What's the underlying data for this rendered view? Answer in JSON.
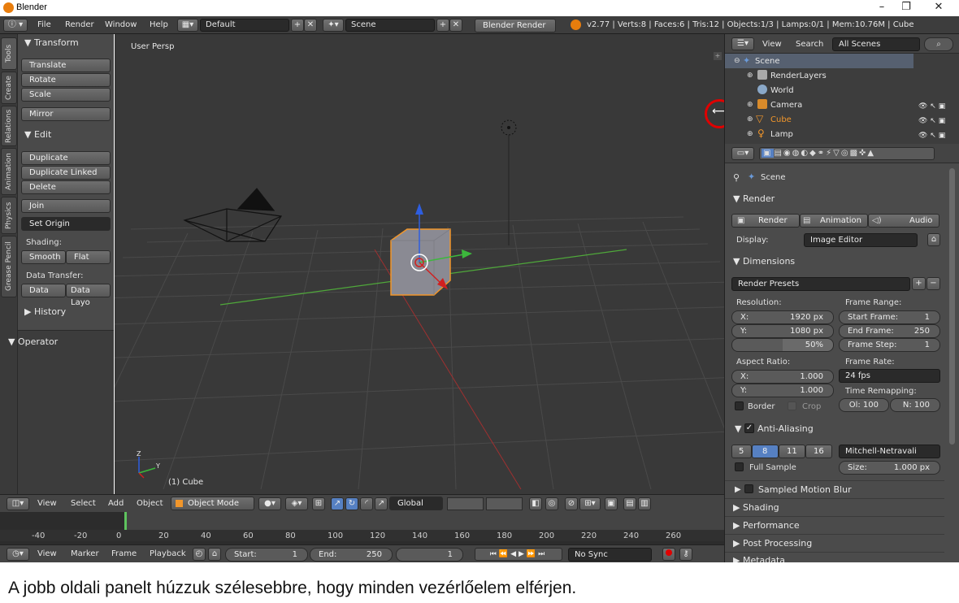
{
  "window": {
    "title": "Blender",
    "minimize": "–",
    "restore": "❐",
    "close": "✕"
  },
  "infobar": {
    "menus": [
      "File",
      "Render",
      "Window",
      "Help"
    ],
    "layout": "Default",
    "scene": "Scene",
    "engine": "Blender Render",
    "stats": "v2.77 | Verts:8 | Faces:6 | Tris:12 | Objects:1/3 | Lamps:0/1 | Mem:10.76M | Cube"
  },
  "tabs": [
    "Tools",
    "Create",
    "Relations",
    "Animation",
    "Physics",
    "Grease Pencil"
  ],
  "toolshelf": {
    "transform": {
      "title": "▼ Transform",
      "buttons": [
        "Translate",
        "Rotate",
        "Scale"
      ],
      "mirror": "Mirror"
    },
    "edit": {
      "title": "▼ Edit",
      "buttons": [
        "Duplicate",
        "Duplicate Linked",
        "Delete"
      ],
      "join": "Join",
      "set_origin": "Set Origin"
    },
    "shading": {
      "label": "Shading:",
      "smooth": "Smooth",
      "flat": "Flat"
    },
    "data_transfer": {
      "label": "Data Transfer:",
      "data": "Data",
      "data_layout": "Data Layo"
    },
    "history": "▶ History",
    "operator": "▼ Operator"
  },
  "viewport": {
    "view_label": "User Persp",
    "object_label": "(1) Cube",
    "axis_x": "Y",
    "axis_z": "Z"
  },
  "viewport_header": {
    "menus": [
      "View",
      "Select",
      "Add",
      "Object"
    ],
    "mode": "Object Mode",
    "orientation": "Global"
  },
  "timeline": {
    "ticks": [
      "-40",
      "-20",
      "0",
      "20",
      "40",
      "60",
      "80",
      "100",
      "120",
      "140",
      "160",
      "180",
      "200",
      "220",
      "240",
      "260"
    ],
    "menus": [
      "View",
      "Marker",
      "Frame",
      "Playback"
    ],
    "start_label": "Start:",
    "start": "1",
    "end_label": "End:",
    "end": "250",
    "current": "1",
    "sync": "No Sync"
  },
  "outliner": {
    "view": "View",
    "search": "Search",
    "filter": "All Scenes",
    "items": [
      {
        "name": "Scene"
      },
      {
        "name": "RenderLayers"
      },
      {
        "name": "World"
      },
      {
        "name": "Camera"
      },
      {
        "name": "Cube"
      },
      {
        "name": "Lamp"
      }
    ]
  },
  "properties": {
    "context": "Scene",
    "render": {
      "title": "▼ Render",
      "render_btn": "Render",
      "animation_btn": "Animation",
      "audio_btn": "Audio",
      "display_label": "Display:",
      "display": "Image Editor"
    },
    "dimensions": {
      "title": "▼ Dimensions",
      "presets": "Render Presets",
      "resolution_label": "Resolution:",
      "res_x_label": "X:",
      "res_x": "1920 px",
      "res_y_label": "Y:",
      "res_y": "1080 px",
      "res_pct": "50%",
      "frame_range_label": "Frame Range:",
      "start_label": "Start Frame:",
      "start": "1",
      "end_label": "End Frame:",
      "end": "250",
      "step_label": "Frame Step:",
      "step": "1",
      "aspect_label": "Aspect Ratio:",
      "aspect_x_label": "X:",
      "aspect_x": "1.000",
      "aspect_y_label": "Y:",
      "aspect_y": "1.000",
      "frame_rate_label": "Frame Rate:",
      "frame_rate": "24 fps",
      "time_remap_label": "Time Remapping:",
      "old": "Ol: 100",
      "new": "N: 100",
      "border": "Border",
      "crop": "Crop"
    },
    "anti_aliasing": {
      "title": "Anti-Aliasing",
      "samples": [
        "5",
        "8",
        "11",
        "16"
      ],
      "active_sample": "8",
      "filter": "Mitchell-Netravali",
      "full_sample": "Full Sample",
      "size_label": "Size:",
      "size": "1.000 px"
    },
    "collapsed": [
      "Sampled Motion Blur",
      "▶ Shading",
      "▶ Performance",
      "▶ Post Processing",
      "▶ Metadata"
    ]
  },
  "caption": "A jobb oldali panelt húzzuk szélesebbre, hogy minden vezérlőelem elférjen.",
  "colors": {
    "accent": "#5680c2",
    "highlight": "#e00000",
    "selection": "#f1962b"
  }
}
